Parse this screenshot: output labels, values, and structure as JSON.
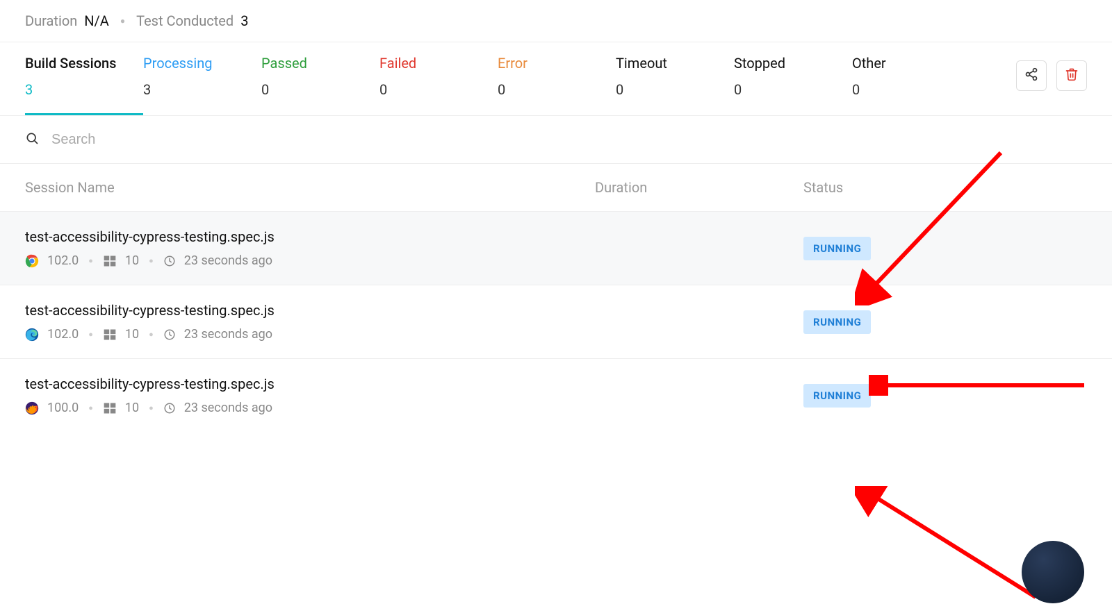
{
  "meta": {
    "duration_label": "Duration",
    "duration_value": "N/A",
    "tests_label": "Test Conducted",
    "tests_value": "3"
  },
  "tabs": [
    {
      "key": "build",
      "label": "Build Sessions",
      "count": "3"
    },
    {
      "key": "processing",
      "label": "Processing",
      "count": "3"
    },
    {
      "key": "passed",
      "label": "Passed",
      "count": "0"
    },
    {
      "key": "failed",
      "label": "Failed",
      "count": "0"
    },
    {
      "key": "error",
      "label": "Error",
      "count": "0"
    },
    {
      "key": "timeout",
      "label": "Timeout",
      "count": "0"
    },
    {
      "key": "stopped",
      "label": "Stopped",
      "count": "0"
    },
    {
      "key": "other",
      "label": "Other",
      "count": "0"
    }
  ],
  "search": {
    "placeholder": "Search"
  },
  "columns": {
    "session": "Session Name",
    "duration": "Duration",
    "status": "Status"
  },
  "sessions": [
    {
      "name": "test-accessibility-cypress-testing.spec.js",
      "browser": "chrome",
      "browser_version": "102.0",
      "os": "windows",
      "os_version": "10",
      "time": "23 seconds ago",
      "status": "RUNNING",
      "highlight": true
    },
    {
      "name": "test-accessibility-cypress-testing.spec.js",
      "browser": "edge",
      "browser_version": "102.0",
      "os": "windows",
      "os_version": "10",
      "time": "23 seconds ago",
      "status": "RUNNING",
      "highlight": false
    },
    {
      "name": "test-accessibility-cypress-testing.spec.js",
      "browser": "firefox",
      "browser_version": "100.0",
      "os": "windows",
      "os_version": "10",
      "time": "23 seconds ago",
      "status": "RUNNING",
      "highlight": false
    }
  ]
}
